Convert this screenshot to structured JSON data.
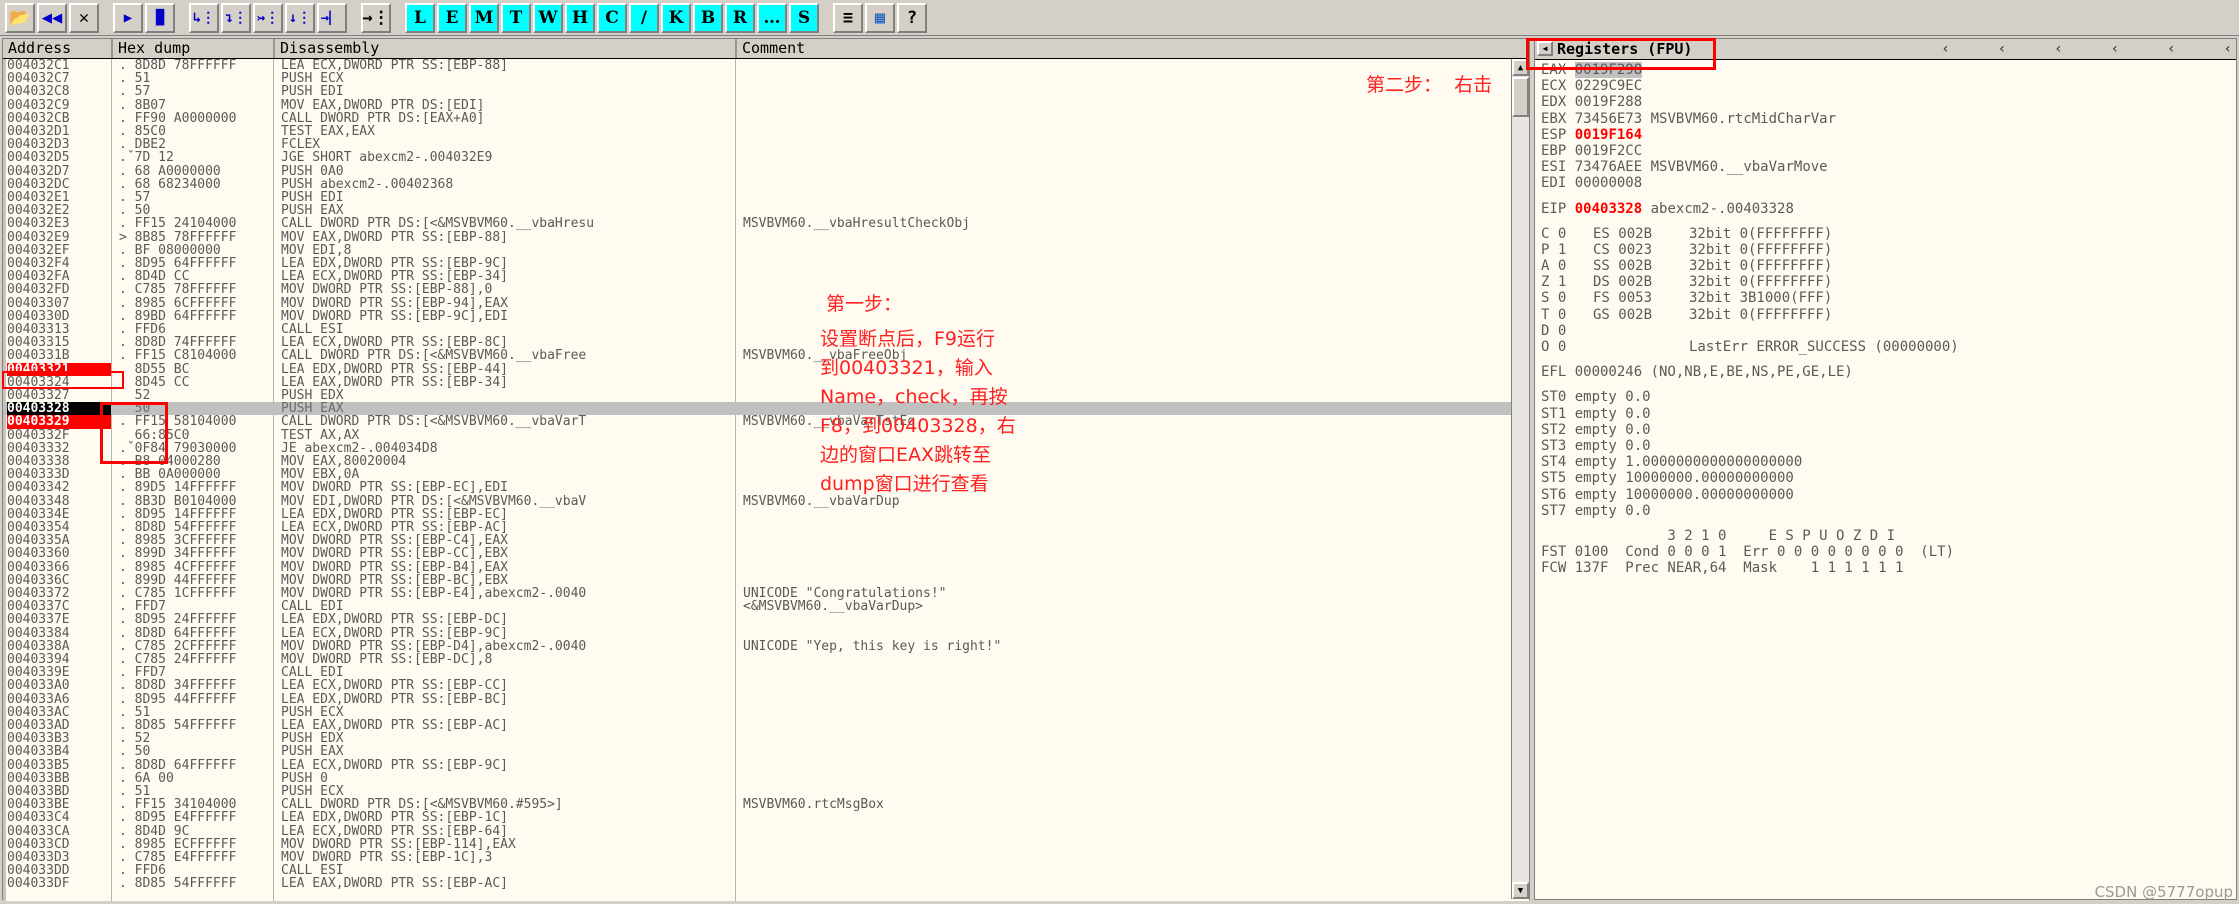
{
  "toolbar": {
    "buttons": [
      {
        "name": "open-file-icon",
        "glyph": "📂",
        "kind": "icon"
      },
      {
        "name": "restart-icon",
        "glyph": "◀◀",
        "kind": "icon-blue-dark"
      },
      {
        "name": "close-icon",
        "glyph": "✕",
        "kind": "icon"
      },
      {
        "name": "run-icon",
        "glyph": "▶",
        "kind": "icon-blue"
      },
      {
        "name": "pause-icon",
        "glyph": "▐▌",
        "kind": "icon-blue"
      },
      {
        "name": "step-into-icon",
        "glyph": "↳⋮",
        "kind": "icon-blue"
      },
      {
        "name": "step-over-icon",
        "glyph": "↴⋮",
        "kind": "icon-blue"
      },
      {
        "name": "trace-into-icon",
        "glyph": "↣⋮",
        "kind": "icon-blue"
      },
      {
        "name": "trace-over-icon",
        "glyph": "↓⋮",
        "kind": "icon-blue"
      },
      {
        "name": "execute-till-return-icon",
        "glyph": "→⎸",
        "kind": "icon-blue"
      },
      {
        "name": "animate-icon",
        "glyph": "→⋮",
        "kind": "icon"
      },
      {
        "name": "log-window-button",
        "glyph": "L",
        "kind": "letter"
      },
      {
        "name": "executable-modules-button",
        "glyph": "E",
        "kind": "letter"
      },
      {
        "name": "memory-map-button",
        "glyph": "M",
        "kind": "letter"
      },
      {
        "name": "threads-button",
        "glyph": "T",
        "kind": "letter"
      },
      {
        "name": "windows-button",
        "glyph": "W",
        "kind": "letter"
      },
      {
        "name": "handles-button",
        "glyph": "H",
        "kind": "letter"
      },
      {
        "name": "cpu-button",
        "glyph": "C",
        "kind": "letter"
      },
      {
        "name": "patches-button",
        "glyph": "/",
        "kind": "letter"
      },
      {
        "name": "call-stack-button",
        "glyph": "K",
        "kind": "letter"
      },
      {
        "name": "breakpoints-button",
        "glyph": "B",
        "kind": "letter"
      },
      {
        "name": "references-button",
        "glyph": "R",
        "kind": "letter"
      },
      {
        "name": "run-trace-button",
        "glyph": "…",
        "kind": "letter"
      },
      {
        "name": "source-button",
        "glyph": "S",
        "kind": "letter"
      },
      {
        "name": "options-list-icon",
        "glyph": "≡",
        "kind": "icon"
      },
      {
        "name": "appearance-icon",
        "glyph": "▦",
        "kind": "icon-color"
      },
      {
        "name": "help-button",
        "glyph": "?",
        "kind": "icon"
      }
    ]
  },
  "cpu": {
    "columns": [
      "Address",
      "Hex dump",
      "Disassembly",
      "Comment"
    ],
    "rows": [
      {
        "addr": "004032C1",
        "hex": ". 8D8D 78FFFFFF",
        "dis": "LEA ECX,DWORD PTR SS:[EBP-88]",
        "cmt": ""
      },
      {
        "addr": "004032C7",
        "hex": ". 51",
        "dis": "PUSH ECX",
        "cmt": ""
      },
      {
        "addr": "004032C8",
        "hex": ". 57",
        "dis": "PUSH EDI",
        "cmt": ""
      },
      {
        "addr": "004032C9",
        "hex": ". 8B07",
        "dis": "MOV EAX,DWORD PTR DS:[EDI]",
        "cmt": ""
      },
      {
        "addr": "004032CB",
        "hex": ". FF90 A0000000",
        "dis": "CALL DWORD PTR DS:[EAX+A0]",
        "cmt": ""
      },
      {
        "addr": "004032D1",
        "hex": ". 85C0",
        "dis": "TEST EAX,EAX",
        "cmt": ""
      },
      {
        "addr": "004032D3",
        "hex": ". DBE2",
        "dis": "FCLEX",
        "cmt": ""
      },
      {
        "addr": "004032D5",
        "hex": ".ˇ7D 12",
        "dis": "JGE SHORT abexcm2-.004032E9",
        "cmt": ""
      },
      {
        "addr": "004032D7",
        "hex": ". 68 A0000000",
        "dis": "PUSH 0A0",
        "cmt": ""
      },
      {
        "addr": "004032DC",
        "hex": ". 68 68234000",
        "dis": "PUSH abexcm2-.00402368",
        "cmt": ""
      },
      {
        "addr": "004032E1",
        "hex": ". 57",
        "dis": "PUSH EDI",
        "cmt": ""
      },
      {
        "addr": "004032E2",
        "hex": ". 50",
        "dis": "PUSH EAX",
        "cmt": ""
      },
      {
        "addr": "004032E3",
        "hex": ". FF15 24104000",
        "dis": "CALL DWORD PTR DS:[<&MSVBVM60.__vbaHresu",
        "cmt": "MSVBVM60.__vbaHresultCheckObj"
      },
      {
        "addr": "004032E9",
        "hex": "> 8B85 78FFFFFF",
        "dis": "MOV EAX,DWORD PTR SS:[EBP-88]",
        "cmt": ""
      },
      {
        "addr": "004032EF",
        "hex": ". BF 08000000",
        "dis": "MOV EDI,8",
        "cmt": ""
      },
      {
        "addr": "004032F4",
        "hex": ". 8D95 64FFFFFF",
        "dis": "LEA EDX,DWORD PTR SS:[EBP-9C]",
        "cmt": ""
      },
      {
        "addr": "004032FA",
        "hex": ". 8D4D CC",
        "dis": "LEA ECX,DWORD PTR SS:[EBP-34]",
        "cmt": ""
      },
      {
        "addr": "004032FD",
        "hex": ". C785 78FFFFFF",
        "dis": "MOV DWORD PTR SS:[EBP-88],0",
        "cmt": ""
      },
      {
        "addr": "00403307",
        "hex": ". 8985 6CFFFFFF",
        "dis": "MOV DWORD PTR SS:[EBP-94],EAX",
        "cmt": ""
      },
      {
        "addr": "0040330D",
        "hex": ". 89BD 64FFFFFF",
        "dis": "MOV DWORD PTR SS:[EBP-9C],EDI",
        "cmt": ""
      },
      {
        "addr": "00403313",
        "hex": ". FFD6",
        "dis": "CALL ESI",
        "cmt": ""
      },
      {
        "addr": "00403315",
        "hex": ". 8D8D 74FFFFFF",
        "dis": "LEA ECX,DWORD PTR SS:[EBP-8C]",
        "cmt": ""
      },
      {
        "addr": "0040331B",
        "hex": ". FF15 C8104000",
        "dis": "CALL DWORD PTR DS:[<&MSVBVM60.__vbaFree",
        "cmt": "MSVBVM60.__vbaFreeObj"
      },
      {
        "addr": "00403321",
        "hex": ". 8D55 BC",
        "dis": "LEA EDX,DWORD PTR SS:[EBP-44]",
        "cmt": "",
        "state": "bp"
      },
      {
        "addr": "00403324",
        "hex": ". 8D45 CC",
        "dis": "LEA EAX,DWORD PTR SS:[EBP-34]",
        "cmt": ""
      },
      {
        "addr": "00403327",
        "hex": "  52",
        "dis": "PUSH EDX",
        "cmt": ""
      },
      {
        "addr": "00403328",
        "hex": "  50",
        "dis": "PUSH EAX",
        "cmt": "",
        "state": "eip"
      },
      {
        "addr": "00403329",
        "hex": ". FF15 58104000",
        "dis": "CALL DWORD PTR DS:[<&MSVBVM60.__vbaVarT",
        "cmt": "MSVBVM60.__vbaVarTstEq",
        "state": "bp"
      },
      {
        "addr": "0040332F",
        "hex": "  66:85C0",
        "dis": "TEST AX,AX",
        "cmt": ""
      },
      {
        "addr": "00403332",
        "hex": ".ˇ0F84 79030000",
        "dis": "JE abexcm2-.004034D8",
        "cmt": ""
      },
      {
        "addr": "00403338",
        "hex": ". B8 04000280",
        "dis": "MOV EAX,80020004",
        "cmt": ""
      },
      {
        "addr": "0040333D",
        "hex": ". BB 0A000000",
        "dis": "MOV EBX,0A",
        "cmt": ""
      },
      {
        "addr": "00403342",
        "hex": ". 89D5 14FFFFFF",
        "dis": "MOV DWORD PTR SS:[EBP-EC],EDI",
        "cmt": ""
      },
      {
        "addr": "00403348",
        "hex": ". 8B3D B0104000",
        "dis": "MOV EDI,DWORD PTR DS:[<&MSVBVM60.__vbaV",
        "cmt": "MSVBVM60.__vbaVarDup"
      },
      {
        "addr": "0040334E",
        "hex": ". 8D95 14FFFFFF",
        "dis": "LEA EDX,DWORD PTR SS:[EBP-EC]",
        "cmt": ""
      },
      {
        "addr": "00403354",
        "hex": ". 8D8D 54FFFFFF",
        "dis": "LEA ECX,DWORD PTR SS:[EBP-AC]",
        "cmt": ""
      },
      {
        "addr": "0040335A",
        "hex": ". 8985 3CFFFFFF",
        "dis": "MOV DWORD PTR SS:[EBP-C4],EAX",
        "cmt": ""
      },
      {
        "addr": "00403360",
        "hex": ". 899D 34FFFFFF",
        "dis": "MOV DWORD PTR SS:[EBP-CC],EBX",
        "cmt": ""
      },
      {
        "addr": "00403366",
        "hex": ". 8985 4CFFFFFF",
        "dis": "MOV DWORD PTR SS:[EBP-B4],EAX",
        "cmt": ""
      },
      {
        "addr": "0040336C",
        "hex": ". 899D 44FFFFFF",
        "dis": "MOV DWORD PTR SS:[EBP-BC],EBX",
        "cmt": ""
      },
      {
        "addr": "00403372",
        "hex": ". C785 1CFFFFFF",
        "dis": "MOV DWORD PTR SS:[EBP-E4],abexcm2-.0040",
        "cmt": "UNICODE \"Congratulations!\""
      },
      {
        "addr": "0040337C",
        "hex": ". FFD7",
        "dis": "CALL EDI",
        "cmt": "<&MSVBVM60.__vbaVarDup>"
      },
      {
        "addr": "0040337E",
        "hex": ". 8D95 24FFFFFF",
        "dis": "LEA EDX,DWORD PTR SS:[EBP-DC]",
        "cmt": ""
      },
      {
        "addr": "00403384",
        "hex": ". 8D8D 64FFFFFF",
        "dis": "LEA ECX,DWORD PTR SS:[EBP-9C]",
        "cmt": ""
      },
      {
        "addr": "0040338A",
        "hex": ". C785 2CFFFFFF",
        "dis": "MOV DWORD PTR SS:[EBP-D4],abexcm2-.0040",
        "cmt": "UNICODE \"Yep, this key is right!\""
      },
      {
        "addr": "00403394",
        "hex": ". C785 24FFFFFF",
        "dis": "MOV DWORD PTR SS:[EBP-DC],8",
        "cmt": ""
      },
      {
        "addr": "0040339E",
        "hex": ". FFD7",
        "dis": "CALL EDI",
        "cmt": ""
      },
      {
        "addr": "004033A0",
        "hex": ". 8D8D 34FFFFFF",
        "dis": "LEA ECX,DWORD PTR SS:[EBP-CC]",
        "cmt": ""
      },
      {
        "addr": "004033A6",
        "hex": ". 8D95 44FFFFFF",
        "dis": "LEA EDX,DWORD PTR SS:[EBP-BC]",
        "cmt": ""
      },
      {
        "addr": "004033AC",
        "hex": ". 51",
        "dis": "PUSH ECX",
        "cmt": ""
      },
      {
        "addr": "004033AD",
        "hex": ". 8D85 54FFFFFF",
        "dis": "LEA EAX,DWORD PTR SS:[EBP-AC]",
        "cmt": ""
      },
      {
        "addr": "004033B3",
        "hex": ". 52",
        "dis": "PUSH EDX",
        "cmt": ""
      },
      {
        "addr": "004033B4",
        "hex": ". 50",
        "dis": "PUSH EAX",
        "cmt": ""
      },
      {
        "addr": "004033B5",
        "hex": ". 8D8D 64FFFFFF",
        "dis": "LEA ECX,DWORD PTR SS:[EBP-9C]",
        "cmt": ""
      },
      {
        "addr": "004033BB",
        "hex": ". 6A 00",
        "dis": "PUSH 0",
        "cmt": ""
      },
      {
        "addr": "004033BD",
        "hex": ". 51",
        "dis": "PUSH ECX",
        "cmt": ""
      },
      {
        "addr": "004033BE",
        "hex": ". FF15 34104000",
        "dis": "CALL DWORD PTR DS:[<&MSVBVM60.#595>]",
        "cmt": "MSVBVM60.rtcMsgBox"
      },
      {
        "addr": "004033C4",
        "hex": ". 8D95 E4FFFFFF",
        "dis": "LEA EDX,DWORD PTR SS:[EBP-1C]",
        "cmt": ""
      },
      {
        "addr": "004033CA",
        "hex": ". 8D4D 9C",
        "dis": "LEA ECX,DWORD PTR SS:[EBP-64]",
        "cmt": ""
      },
      {
        "addr": "004033CD",
        "hex": ". 8985 ECFFFFFF",
        "dis": "MOV DWORD PTR SS:[EBP-114],EAX",
        "cmt": ""
      },
      {
        "addr": "004033D3",
        "hex": ". C785 E4FFFFFF",
        "dis": "MOV DWORD PTR SS:[EBP-1C],3",
        "cmt": ""
      },
      {
        "addr": "004033DD",
        "hex": ". FFD6",
        "dis": "CALL ESI",
        "cmt": ""
      },
      {
        "addr": "004033DF",
        "hex": ". 8D85 54FFFFFF",
        "dis": "LEA EAX,DWORD PTR SS:[EBP-AC]",
        "cmt": ""
      }
    ]
  },
  "registers": {
    "title": "Registers (FPU)",
    "lines": [
      {
        "name": "EAX",
        "value": "0019F298",
        "extra": "",
        "style": "sel"
      },
      {
        "name": "ECX",
        "value": "0229C9EC",
        "extra": "",
        "style": ""
      },
      {
        "name": "EDX",
        "value": "0019F288",
        "extra": "",
        "style": ""
      },
      {
        "name": "EBX",
        "value": "73456E73",
        "extra": "MSVBVM60.rtcMidCharVar",
        "style": ""
      },
      {
        "name": "ESP",
        "value": "0019F164",
        "extra": "",
        "style": "red"
      },
      {
        "name": "EBP",
        "value": "0019F2CC",
        "extra": "",
        "style": ""
      },
      {
        "name": "ESI",
        "value": "73476AEE",
        "extra": "MSVBVM60.__vbaVarMove",
        "style": ""
      },
      {
        "name": "EDI",
        "value": "00000008",
        "extra": "",
        "style": ""
      },
      {
        "spacer": true
      },
      {
        "name": "EIP",
        "value": "00403328",
        "extra": "abexcm2-.00403328",
        "style": "red"
      },
      {
        "spacer": true
      }
    ],
    "flags": [
      {
        "f": "C 0",
        "seg": "ES 002B",
        "desc": "32bit 0(FFFFFFFF)"
      },
      {
        "f": "P 1",
        "seg": "CS 0023",
        "desc": "32bit 0(FFFFFFFF)"
      },
      {
        "f": "A 0",
        "seg": "SS 002B",
        "desc": "32bit 0(FFFFFFFF)"
      },
      {
        "f": "Z 1",
        "seg": "DS 002B",
        "desc": "32bit 0(FFFFFFFF)"
      },
      {
        "f": "S 0",
        "seg": "FS 0053",
        "desc": "32bit 3B1000(FFF)"
      },
      {
        "f": "T 0",
        "seg": "GS 002B",
        "desc": "32bit 0(FFFFFFFF)"
      },
      {
        "f": "D 0",
        "seg": "",
        "desc": ""
      },
      {
        "f": "O 0",
        "seg": "",
        "desc": "LastErr ERROR_SUCCESS (00000000)"
      }
    ],
    "efl": "EFL 00000246 (NO,NB,E,BE,NS,PE,GE,LE)",
    "fpu": [
      "ST0 empty 0.0",
      "ST1 empty 0.0",
      "ST2 empty 0.0",
      "ST3 empty 0.0",
      "ST4 empty 1.0000000000000000000",
      "ST5 empty 10000000.00000000000",
      "ST6 empty 10000000.00000000000",
      "ST7 empty 0.0"
    ],
    "fpu_header": "               3 2 1 0     E S P U O Z D I",
    "fst": "FST 0100  Cond 0 0 0 1  Err 0 0 0 0 0 0 0 0  (LT)",
    "fcw": "FCW 137F  Prec NEAR,64  Mask    1 1 1 1 1 1",
    "chevrons": [
      "‹",
      "‹",
      "‹",
      "‹",
      "‹",
      "‹"
    ]
  },
  "annotations": {
    "step1_title": "第一步：",
    "step1_body": "设置断点后，F9运行\n到00403321，输入\nName，check，再按\nF8，到00403328，右\n边的窗口EAX跳转至\ndump窗口进行查看",
    "step2": "第二步：  右击"
  },
  "watermark": "CSDN @5777opup",
  "colors": {
    "red": "#ff0000",
    "cyan": "#00ffff",
    "listing_bg": "#fffbf0",
    "chrome": "#d4d0c8"
  }
}
